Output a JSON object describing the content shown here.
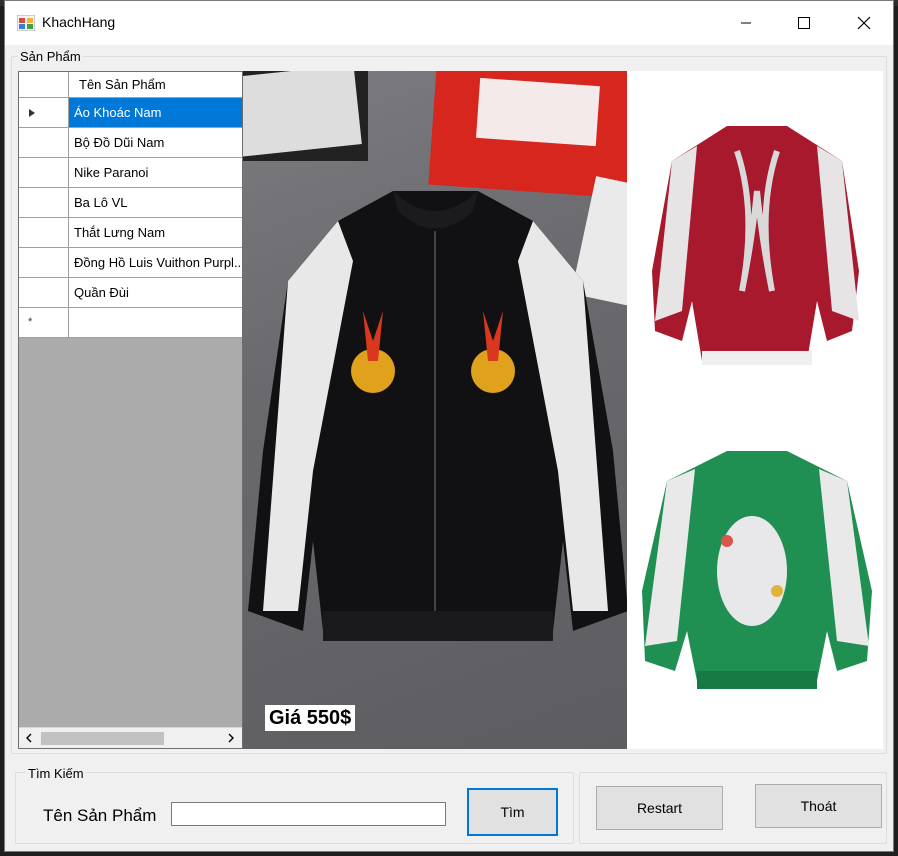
{
  "window": {
    "title": "KhachHang"
  },
  "products_group": {
    "label": "Sản Phẩm",
    "column_header": "Tên Sản Phẩm",
    "rows": [
      "Áo Khoác Nam",
      "Bộ Đồ Dũi Nam",
      "Nike Paranoi",
      "Ba Lô VL",
      "Thắt Lưng Nam",
      "Đồng Hồ Luis Vuithon Purpl...",
      "Quần Đùi"
    ],
    "selected_row": 0,
    "new_row_marker": "*"
  },
  "image": {
    "price": "Giá 550$"
  },
  "search_group": {
    "label": "Tìm Kiếm",
    "field_label": "Tên Sản Phẩm",
    "field_value": "",
    "button": "Tìm"
  },
  "actions": {
    "restart": "Restart",
    "exit": "Thoát"
  },
  "colors": {
    "selection": "#0078d7",
    "window_bg": "#f0f0f0"
  }
}
